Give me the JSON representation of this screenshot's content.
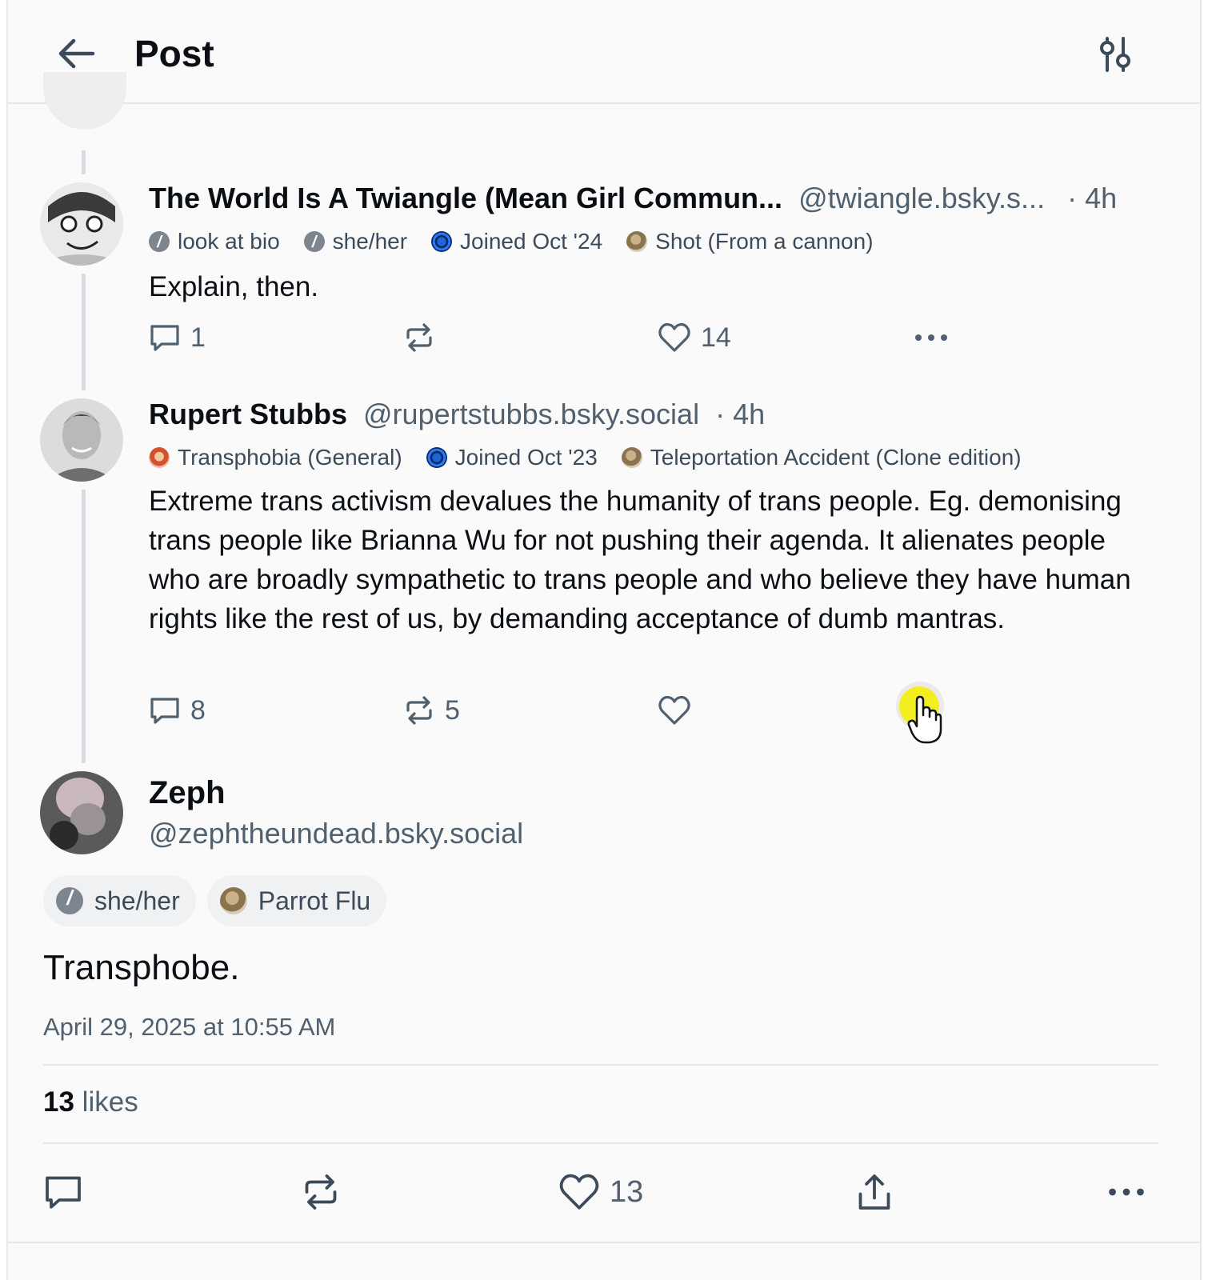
{
  "header": {
    "title": "Post",
    "back_icon": "arrow-left-icon",
    "filter_icon": "sliders-icon"
  },
  "posts": [
    {
      "name": "The World Is A Twiangle (Mean Girl Commun...",
      "handle": "@twiangle.bsky.s...",
      "time": "· 4h",
      "badges": [
        {
          "icon": "info",
          "label": "look at bio"
        },
        {
          "icon": "info",
          "label": "she/her"
        },
        {
          "icon": "globe",
          "label": "Joined Oct '24"
        },
        {
          "icon": "sepia",
          "label": "Shot (From a cannon)"
        }
      ],
      "text": "Explain, then.",
      "replies": "1",
      "reposts": "",
      "likes": "14"
    },
    {
      "name": "Rupert Stubbs",
      "handle": "@rupertstubbs.bsky.social",
      "time": "· 4h",
      "badges": [
        {
          "icon": "face",
          "label": "Transphobia (General)"
        },
        {
          "icon": "globe",
          "label": "Joined Oct '23"
        },
        {
          "icon": "sepia",
          "label": "Teleportation Accident (Clone edition)"
        }
      ],
      "text": "Extreme trans activism devalues the humanity of trans people. Eg. demonising trans people like Brianna Wu for not pushing their agenda. It alienates people who are broadly sympathetic to trans people and who believe they have human rights like the rest of us, by demanding acceptance of dumb mantras.",
      "replies": "8",
      "reposts": "5",
      "likes": ""
    }
  ],
  "main_post": {
    "name": "Zeph",
    "handle": "@zephtheundead.bsky.social",
    "pills": [
      {
        "icon": "info",
        "label": "she/her"
      },
      {
        "icon": "sepia",
        "label": "Parrot Flu"
      }
    ],
    "text": "Transphobe.",
    "timestamp": "April 29, 2025 at 10:55 AM",
    "likes_count": "13",
    "likes_label": "likes",
    "like_action_count": "13"
  },
  "colors": {
    "muted": "#51606f",
    "text": "#0b0f14",
    "thread_line": "#d9dde2",
    "background": "#fafafa"
  }
}
